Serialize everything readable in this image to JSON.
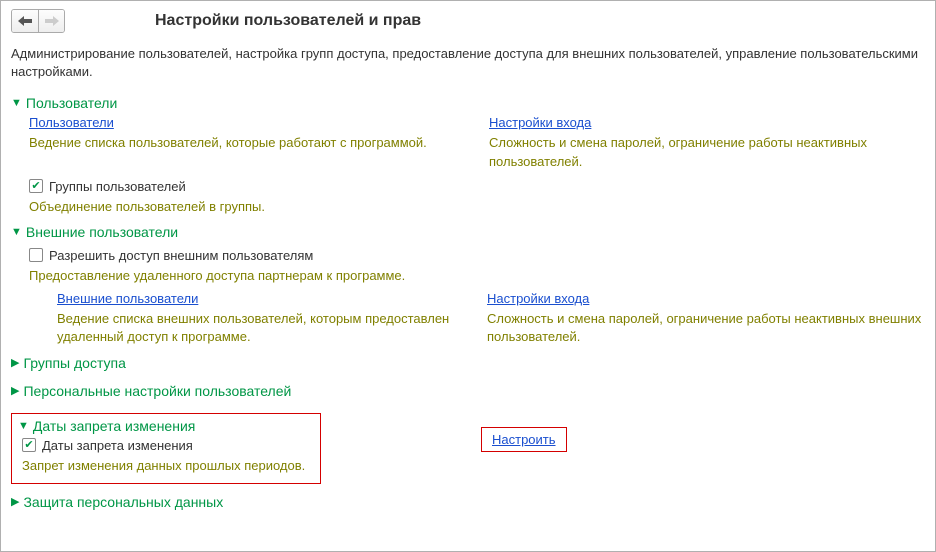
{
  "header": {
    "title": "Настройки пользователей и прав",
    "description": "Администрирование пользователей, настройка групп доступа, предоставление доступа для внешних пользователей, управление пользовательскими настройками."
  },
  "sections": {
    "users": {
      "title": "Пользователи",
      "link_users": "Пользователи",
      "hint_users": "Ведение списка пользователей, которые работают с программой.",
      "link_login": "Настройки входа",
      "hint_login": "Сложность и смена паролей, ограничение работы неактивных пользователей.",
      "group_users_label": "Группы пользователей",
      "group_users_hint": "Объединение пользователей в группы."
    },
    "external": {
      "title": "Внешние пользователи",
      "allow_label": "Разрешить доступ внешним пользователям",
      "allow_hint": "Предоставление удаленного доступа партнерам к программе.",
      "link_ext_users": "Внешние пользователи",
      "hint_ext_users": "Ведение списка внешних пользователей, которым предоставлен удаленный доступ к программе.",
      "link_login": "Настройки входа",
      "hint_login": "Сложность и смена паролей, ограничение работы неактивных внешних пользователей."
    },
    "access_groups": {
      "title": "Группы доступа"
    },
    "personal": {
      "title": "Персональные настройки пользователей"
    },
    "change_ban": {
      "title": "Даты запрета изменения",
      "check_label": "Даты запрета изменения",
      "check_hint": "Запрет изменения данных прошлых периодов.",
      "configure": "Настроить"
    },
    "personal_data": {
      "title": "Защита персональных данных"
    }
  }
}
